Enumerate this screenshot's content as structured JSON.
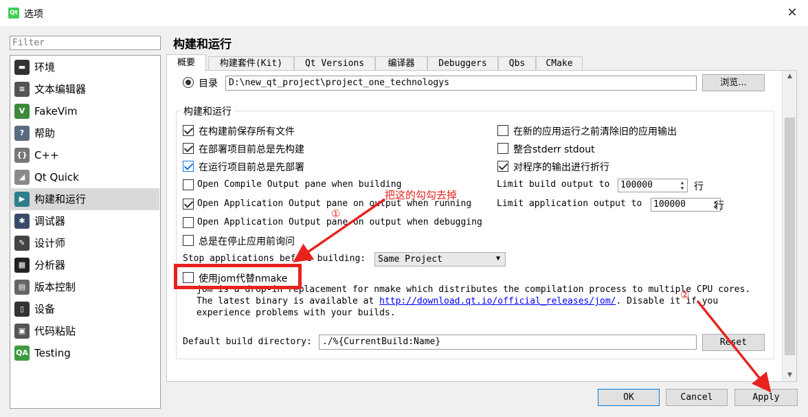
{
  "window": {
    "app_icon": "Qt",
    "title": "选项",
    "close_glyph": "✕"
  },
  "filter": {
    "placeholder": "Filter"
  },
  "sidebar": {
    "items": [
      {
        "label": "环境",
        "icon": "monitor-icon",
        "icon_color": "#333333",
        "icon_glyph": "▬"
      },
      {
        "label": "文本编辑器",
        "icon": "text-editor-icon",
        "icon_color": "#555555",
        "icon_glyph": "≡"
      },
      {
        "label": "FakeVim",
        "icon": "fakevim-icon",
        "icon_color": "#3c8a3c",
        "icon_glyph": "V"
      },
      {
        "label": "帮助",
        "icon": "help-icon",
        "icon_color": "#5a6a80",
        "icon_glyph": "?"
      },
      {
        "label": "C++",
        "icon": "cpp-icon",
        "icon_color": "#777777",
        "icon_glyph": "{}"
      },
      {
        "label": "Qt Quick",
        "icon": "qt-quick-icon",
        "icon_color": "#8a8a8a",
        "icon_glyph": "◢"
      },
      {
        "label": "构建和运行",
        "icon": "build-run-icon",
        "icon_color": "#2e7d8a",
        "icon_glyph": "▶"
      },
      {
        "label": "调试器",
        "icon": "debugger-icon",
        "icon_color": "#3a4a6a",
        "icon_glyph": "✱"
      },
      {
        "label": "设计师",
        "icon": "designer-icon",
        "icon_color": "#444444",
        "icon_glyph": "✎"
      },
      {
        "label": "分析器",
        "icon": "analyzer-icon",
        "icon_color": "#222222",
        "icon_glyph": "▦"
      },
      {
        "label": "版本控制",
        "icon": "version-control-icon",
        "icon_color": "#666666",
        "icon_glyph": "▤"
      },
      {
        "label": "设备",
        "icon": "devices-icon",
        "icon_color": "#333333",
        "icon_glyph": "▯"
      },
      {
        "label": "代码粘贴",
        "icon": "code-paste-icon",
        "icon_color": "#555555",
        "icon_glyph": "▣"
      },
      {
        "label": "Testing",
        "icon": "qa-icon",
        "icon_color": "#3c9a3c",
        "icon_glyph": "QA"
      }
    ],
    "selected_index": 6
  },
  "page": {
    "title": "构建和运行"
  },
  "tabs": [
    {
      "label": "概要"
    },
    {
      "label": "构建套件(Kit)"
    },
    {
      "label": "Qt Versions"
    },
    {
      "label": "编译器"
    },
    {
      "label": "Debuggers"
    },
    {
      "label": "Qbs"
    },
    {
      "label": "CMake"
    }
  ],
  "directory": {
    "label": "目录",
    "value": "D:\\new_qt_project\\project_one_technologys",
    "browse_label": "浏览..."
  },
  "build_run": {
    "group_title": "构建和运行",
    "left_options": [
      {
        "label": "在构建前保存所有文件",
        "checked": true
      },
      {
        "label": "在部署项目前总是先构建",
        "checked": true
      },
      {
        "label": "在运行项目前总是先部署",
        "checked": true
      },
      {
        "label": "Open Compile Output pane when building",
        "checked": false
      },
      {
        "label": "Open Application Output pane on output when running",
        "checked": true
      },
      {
        "label": "Open Application Output pane on output when debugging",
        "checked": false
      },
      {
        "label": "总是在停止应用前询问",
        "checked": false
      }
    ],
    "right_options": [
      {
        "label": "在新的应用运行之前清除旧的应用输出",
        "checked": false
      },
      {
        "label": "整合stderr stdout",
        "checked": false
      },
      {
        "label": "对程序的输出进行折行",
        "checked": true
      }
    ],
    "limit_build_label": "Limit build output to",
    "limit_build_value": "100000",
    "limit_build_unit": "行",
    "limit_app_label": "Limit application output to",
    "limit_app_value": "100000",
    "limit_app_unit": "行",
    "stop_apps_label": "Stop applications before building:",
    "stop_apps_value": "Same Project",
    "jom": {
      "label": "使用jom代替nmake",
      "checked": false
    },
    "jom_desc_line1": "jom is a drop-in replacement for nmake which distributes the compilation process to multiple CPU cores.",
    "jom_desc_line2_prefix": "The latest binary is available at ",
    "jom_desc_link": "http://download.qt.io/official_releases/jom/",
    "jom_desc_line2_suffix": ". Disable it if you",
    "jom_desc_line3": "experience problems with your builds.",
    "default_dir_label": "Default build directory:",
    "default_dir_value": "./%{CurrentBuild:Name}",
    "reset_label": "Reset"
  },
  "footer": {
    "ok_label": "OK",
    "cancel_label": "Cancel",
    "apply_label": "Apply"
  },
  "annotations": {
    "instruction": "把这的勾勾去掉",
    "marker1": "①",
    "marker2": "②",
    "color": "#e8231f"
  }
}
